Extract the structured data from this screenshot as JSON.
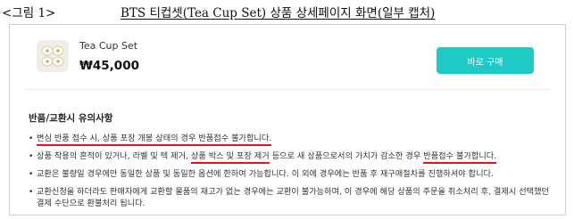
{
  "caption": {
    "figure_label": "<그림 1>",
    "title": "BTS 티컵셋(Tea Cup Set) 상품 상세페이지 화면(일부 캡처)"
  },
  "product": {
    "name": "Tea Cup Set",
    "price": "₩45,000",
    "buy_button_label": "바로 구매",
    "accent_color": "#1ec9c6"
  },
  "notice": {
    "title": "반품/교환시 유의사항",
    "bullet": "•",
    "items": [
      {
        "before": "변심 반품 접수 시, 상품 포장 개봉 상태의 경우 반품접수 불가합니다.",
        "underlined": true
      },
      {
        "part1": "상품 착용의 흔적이 있거나, 라벨 및 텍 제거, ",
        "hl1": "상품 박스 및 포장 제거",
        "part2": " 등으로 새 상품으로서의 가치가 감소한 경우 ",
        "hl2": "반품접수 불가합니다."
      },
      {
        "text": "교환은 불량일 경우에만 동일한 상품 및 동일한 옵션에 한하여 가능합니다. 이 외에 경우에는 반품 후 재구매절차를 진행하셔야 합니다."
      },
      {
        "text": "교환신청을 하더라도 판매자에게 교환할 물품의 재고가 없는 경우에는 교환이 불가능하며, 이 경우에 해당 상품의 주문을 취소처리 후, 결제시 선택했던 결제 수단으로 환불처리 됩니다."
      }
    ],
    "underline_color": "#e1151b"
  }
}
